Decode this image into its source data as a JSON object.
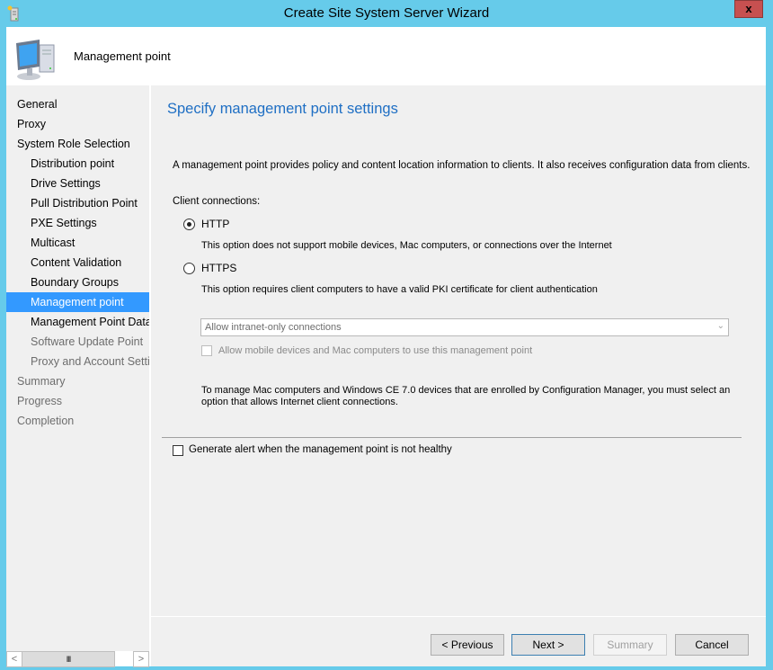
{
  "window": {
    "title": "Create Site System Server Wizard",
    "close_label": "x",
    "app_icon": "server-wizard-icon"
  },
  "header": {
    "title": "Management point",
    "icon": "computer-icon"
  },
  "sidebar": {
    "items": [
      {
        "label": "General",
        "level": 0,
        "state": "normal"
      },
      {
        "label": "Proxy",
        "level": 0,
        "state": "normal"
      },
      {
        "label": "System Role Selection",
        "level": 0,
        "state": "normal"
      },
      {
        "label": "Distribution point",
        "level": 1,
        "state": "normal"
      },
      {
        "label": "Drive Settings",
        "level": 1,
        "state": "normal"
      },
      {
        "label": "Pull Distribution Point",
        "level": 1,
        "state": "normal"
      },
      {
        "label": "PXE Settings",
        "level": 1,
        "state": "normal"
      },
      {
        "label": "Multicast",
        "level": 1,
        "state": "normal"
      },
      {
        "label": "Content Validation",
        "level": 1,
        "state": "normal"
      },
      {
        "label": "Boundary Groups",
        "level": 1,
        "state": "normal"
      },
      {
        "label": "Management point",
        "level": 1,
        "state": "active"
      },
      {
        "label": "Management Point Datab",
        "level": 1,
        "state": "normal"
      },
      {
        "label": "Software Update Point",
        "level": 1,
        "state": "disabled"
      },
      {
        "label": "Proxy and Account Settin",
        "level": 1,
        "state": "disabled"
      },
      {
        "label": "Summary",
        "level": 0,
        "state": "disabled"
      },
      {
        "label": "Progress",
        "level": 0,
        "state": "disabled"
      },
      {
        "label": "Completion",
        "level": 0,
        "state": "disabled"
      }
    ],
    "scroll_left": "<",
    "scroll_right": ">",
    "scroll_thumb": "III"
  },
  "content": {
    "page_title": "Specify management point settings",
    "description": "A management point provides policy and content location information to clients.  It also receives configuration data from clients.",
    "client_connections_label": "Client connections:",
    "options": [
      {
        "label": "HTTP",
        "selected": true,
        "description": "This option does not support mobile devices, Mac computers, or connections over the Internet"
      },
      {
        "label": "HTTPS",
        "selected": false,
        "description": "This option requires client computers to have a valid PKI certificate for client authentication"
      }
    ],
    "connection_select": {
      "value": "Allow intranet-only connections",
      "enabled": false
    },
    "allow_mobile_checkbox": {
      "label": "Allow mobile devices and Mac computers to use this management point",
      "checked": false,
      "enabled": false
    },
    "note": "To manage Mac computers and Windows CE 7.0 devices that are enrolled by Configuration Manager, you must select an option that allows Internet client connections.",
    "alert_checkbox": {
      "label": "Generate alert when the management point is not healthy",
      "checked": false
    }
  },
  "buttons": {
    "previous": "< Previous",
    "next": "Next >",
    "summary": "Summary",
    "cancel": "Cancel"
  }
}
